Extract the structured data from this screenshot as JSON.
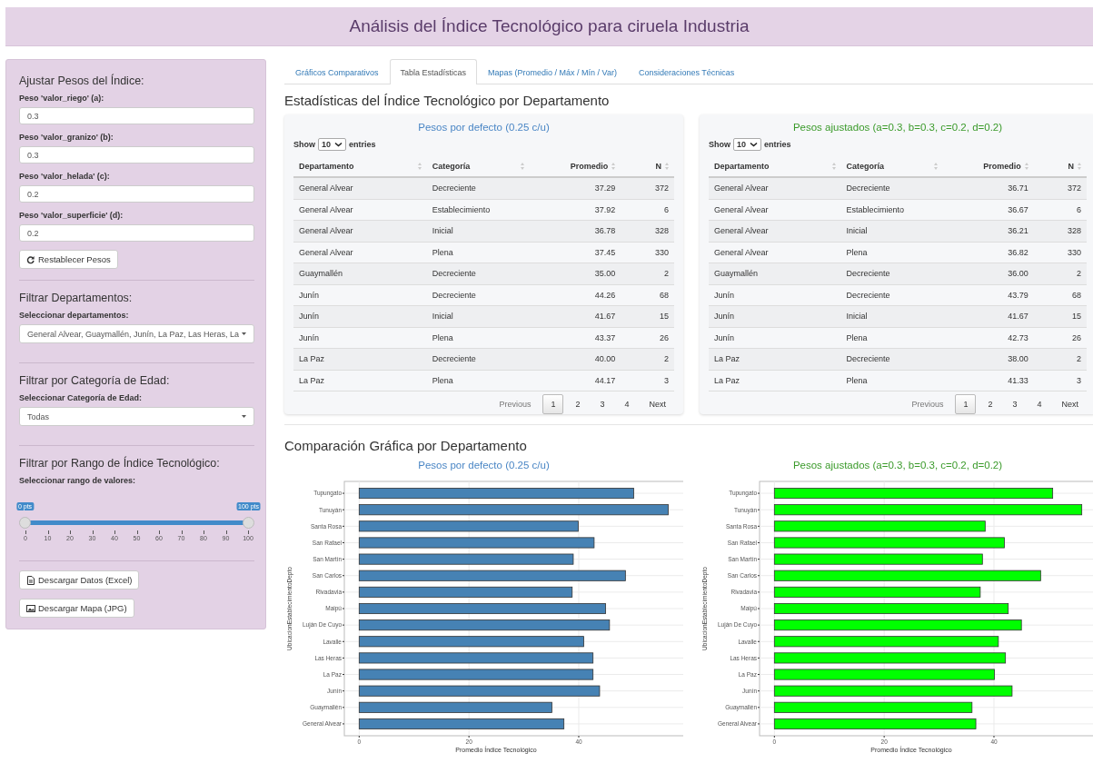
{
  "header": {
    "title": "Análisis del Índice Tecnológico para ciruela Industria"
  },
  "sidebar": {
    "weights_heading": "Ajustar Pesos del Índice:",
    "weights": [
      {
        "label": "Peso 'valor_riego' (a):",
        "value": "0.3"
      },
      {
        "label": "Peso 'valor_granizo' (b):",
        "value": "0.3"
      },
      {
        "label": "Peso 'valor_helada' (c):",
        "value": "0.2"
      },
      {
        "label": "Peso 'valor_superficie' (d):",
        "value": "0.2"
      }
    ],
    "reset_button": "Restablecer Pesos",
    "filters": [
      {
        "heading": "Filtrar Departamentos:",
        "label": "Seleccionar departamentos:",
        "value": "General Alvear, Guaymallén, Junín, La Paz, Las Heras, La"
      },
      {
        "heading": "Filtrar por Categoría de Edad:",
        "label": "Seleccionar Categoría de Edad:",
        "value": "Todas"
      }
    ],
    "range": {
      "heading": "Filtrar por Rango de Índice Tecnológico:",
      "label": "Seleccionar rango de valores:",
      "handles": [
        {
          "label": "0 pts"
        },
        {
          "label": "100 pts"
        }
      ],
      "ticks": [
        "0",
        "10",
        "20",
        "30",
        "40",
        "50",
        "60",
        "70",
        "80",
        "90",
        "100"
      ]
    },
    "downloads": [
      {
        "kind": "file",
        "label": "Descargar Datos (Excel)"
      },
      {
        "kind": "image",
        "label": "Descargar Mapa (JPG)"
      }
    ]
  },
  "tabs": [
    {
      "label": "Gráficos Comparativos",
      "selected": false
    },
    {
      "label": "Tabla Estadísticas",
      "selected": true
    },
    {
      "label": "Mapas (Promedio / Máx / Mín / Var)",
      "selected": false
    },
    {
      "label": "Consideraciones Técnicas",
      "selected": false
    }
  ],
  "stats_heading": "Estadísticas del Índice Tecnológico por Departamento",
  "tables": [
    {
      "title": "Pesos por defecto (0.25 c/u)",
      "color": "#4a86c5",
      "show_label": "Show",
      "page_size": "10",
      "entries_label": "entries",
      "columns": [
        "Departamento",
        "Categoría",
        "Promedio",
        "N"
      ],
      "rows": [
        [
          "General Alvear",
          "Decreciente",
          "37.29",
          "372"
        ],
        [
          "General Alvear",
          "Establecimiento",
          "37.92",
          "6"
        ],
        [
          "General Alvear",
          "Inicial",
          "36.78",
          "328"
        ],
        [
          "General Alvear",
          "Plena",
          "37.45",
          "330"
        ],
        [
          "Guaymallén",
          "Decreciente",
          "35.00",
          "2"
        ],
        [
          "Junín",
          "Decreciente",
          "44.26",
          "68"
        ],
        [
          "Junín",
          "Inicial",
          "41.67",
          "15"
        ],
        [
          "Junín",
          "Plena",
          "43.37",
          "26"
        ],
        [
          "La Paz",
          "Decreciente",
          "40.00",
          "2"
        ],
        [
          "La Paz",
          "Plena",
          "44.17",
          "3"
        ]
      ],
      "pagination": {
        "previous": "Previous",
        "next": "Next",
        "pages": [
          {
            "label": "1",
            "selected": true
          },
          {
            "label": "2",
            "selected": false
          },
          {
            "label": "3",
            "selected": false
          },
          {
            "label": "4",
            "selected": false
          }
        ]
      }
    },
    {
      "title": "Pesos ajustados (a=0.3, b=0.3, c=0.2, d=0.2)",
      "color": "#3a9a2a",
      "show_label": "Show",
      "page_size": "10",
      "entries_label": "entries",
      "columns": [
        "Departamento",
        "Categoría",
        "Promedio",
        "N"
      ],
      "rows": [
        [
          "General Alvear",
          "Decreciente",
          "36.71",
          "372"
        ],
        [
          "General Alvear",
          "Establecimiento",
          "36.67",
          "6"
        ],
        [
          "General Alvear",
          "Inicial",
          "36.21",
          "328"
        ],
        [
          "General Alvear",
          "Plena",
          "36.82",
          "330"
        ],
        [
          "Guaymallén",
          "Decreciente",
          "36.00",
          "2"
        ],
        [
          "Junín",
          "Decreciente",
          "43.79",
          "68"
        ],
        [
          "Junín",
          "Inicial",
          "41.67",
          "15"
        ],
        [
          "Junín",
          "Plena",
          "42.73",
          "26"
        ],
        [
          "La Paz",
          "Decreciente",
          "38.00",
          "2"
        ],
        [
          "La Paz",
          "Plena",
          "41.33",
          "3"
        ]
      ],
      "pagination": {
        "previous": "Previous",
        "next": "Next",
        "pages": [
          {
            "label": "1",
            "selected": true
          },
          {
            "label": "2",
            "selected": false
          },
          {
            "label": "3",
            "selected": false
          },
          {
            "label": "4",
            "selected": false
          }
        ]
      }
    }
  ],
  "charts_heading": "Comparación Gráfica por Departamento",
  "charts": [
    {
      "color": "#4a86c5",
      "chart_data": {
        "type": "bar",
        "orientation": "horizontal",
        "title": "Pesos por defecto (0.25 c/u)",
        "grid": true,
        "xlabel": "Promedio Índice Tecnológico",
        "ylabel": "UbicacionEstablecimientoDepto",
        "xlim": [
          -2.7,
          59.2
        ],
        "xticks": [
          0,
          20,
          40
        ],
        "categories": [
          "Tupungato",
          "Tunuyán",
          "Santa Rosa",
          "San Rafael",
          "San Martín",
          "San Carlos",
          "Rivadavia",
          "Maipú",
          "Luján De Cuyo",
          "Lavalle",
          "Las Heras",
          "La Paz",
          "Junín",
          "Guaymallén",
          "General Alvear"
        ],
        "series": [
          {
            "color": "#4682b4",
            "values": [
              50.0,
              56.3,
              39.9,
              42.8,
              39.0,
              48.5,
              38.8,
              44.9,
              45.6,
              40.9,
              42.6,
              42.6,
              43.8,
              35.1,
              37.3
            ]
          }
        ]
      }
    },
    {
      "color": "#3a9a2a",
      "chart_data": {
        "type": "bar",
        "orientation": "horizontal",
        "title": "Pesos ajustados (a=0.3, b=0.3, c=0.2, d=0.2)",
        "grid": true,
        "xlabel": "Promedio Índice Tecnológico",
        "ylabel": "UbicacionEstablecimientoDepto",
        "xlim": [
          -2.7,
          59.2
        ],
        "xticks": [
          0,
          20,
          40
        ],
        "categories": [
          "Tupungato",
          "Tunuyán",
          "Santa Rosa",
          "San Rafael",
          "San Martín",
          "San Carlos",
          "Rivadavia",
          "Maipú",
          "Luján De Cuyo",
          "Lavalle",
          "Las Heras",
          "La Paz",
          "Junín",
          "Guaymallén",
          "General Alvear"
        ],
        "series": [
          {
            "color": "#00ff00",
            "values": [
              50.7,
              56.0,
              38.4,
              41.9,
              37.9,
              48.5,
              37.5,
              42.6,
              45.0,
              40.8,
              42.1,
              40.1,
              43.3,
              36.0,
              36.7
            ]
          }
        ]
      }
    }
  ]
}
